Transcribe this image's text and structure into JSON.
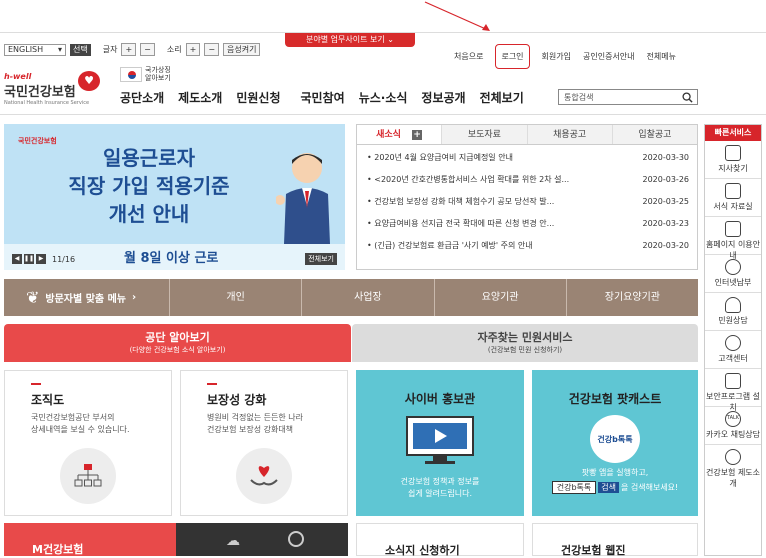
{
  "notice": {
    "label": "분야별 업무사이트 보기"
  },
  "util_left": {
    "language": "ENGLISH",
    "select_btn": "선택",
    "text_size": "글자",
    "sound": "소리",
    "plus": "+",
    "minus": "−",
    "voice_btn": "음성켜기"
  },
  "util_right": {
    "items": [
      "처음으로",
      "로그인",
      "회원가입",
      "공인인증서안내",
      "전체메뉴"
    ]
  },
  "logo": {
    "brand": "h-well",
    "name": "국민건강보험",
    "sub": "National Health Insurance Service",
    "gov": "국가상징 알아보기"
  },
  "gnb": {
    "items": [
      "공단소개",
      "제도소개",
      "민원신청",
      "국민참여",
      "뉴스·소식",
      "정보공개",
      "전체보기"
    ]
  },
  "search": {
    "placeholder": "통합검색"
  },
  "banner": {
    "brand": "국민건강보험",
    "line1": "일용근로자",
    "line2": "직장 가입 적용기준",
    "line3": "개선 안내",
    "footer": "월 8일 이상 근로",
    "page": "11/16",
    "all": "전체보기"
  },
  "news": {
    "tabs": [
      "새소식",
      "보도자료",
      "채용공고",
      "입찰공고"
    ],
    "plus": "+",
    "rows": [
      {
        "title": "2020년 4월 요양급여비 지급예정일 안내",
        "date": "2020-03-30"
      },
      {
        "title": "<2020년 간호간병통합서비스 사업 확대를 위한 2차 설...",
        "date": "2020-03-26"
      },
      {
        "title": "건강보험 보장성 강화 대책 체험수기 공모 당선작 발...",
        "date": "2020-03-25"
      },
      {
        "title": "요양급여비용 선지급 전국 확대에 따른 신청 변경 안...",
        "date": "2020-03-23"
      },
      {
        "title": "(긴급) 건강보험료 환급금 '사기 예방' 주의 안내",
        "date": "2020-03-20"
      }
    ]
  },
  "visitor_menu": {
    "title": "방문자별 맞춤 메뉴",
    "items": [
      "개인",
      "사업장",
      "요양기관",
      "장기요양기관"
    ]
  },
  "section_tabs": [
    {
      "title": "공단 알아보기",
      "sub": "(다양한 건강보험 소식 알아보기)"
    },
    {
      "title": "자주찾는 민원서비스",
      "sub": "(건강보험 민원 신청하기)"
    }
  ],
  "cards": [
    {
      "title": "조직도",
      "desc1": "국민건강보험공단 부서의",
      "desc2": "상세내역을 보실 수 있습니다."
    },
    {
      "title": "보장성 강화",
      "desc1": "병원비 걱정없는 든든한 나라",
      "desc2": "건강보험 보장성 강화대책"
    },
    {
      "title": "사이버 홍보관",
      "desc1": "건강보험 정책과 정보를",
      "desc2": "쉽게 알려드립니다."
    },
    {
      "title": "건강보험 팟캐스트",
      "desc1": "팟빵 앱을 실행하고,",
      "desc2": "을 검색해보세요!",
      "pill": "건강b톡톡",
      "pill_btn": "검색",
      "badge": "건강b톡톡"
    }
  ],
  "bottom_cards": [
    "M건강보험",
    "소식지 신청하기",
    "건강보험 웹진"
  ],
  "quick": {
    "title": "빠른서비스",
    "items": [
      "지사찾기",
      "서식 자료실",
      "홈페이지 이용안내",
      "인터넷납부",
      "민원상담",
      "고객센터",
      "보안프로그램 설치",
      "카카오 채팅상담",
      "건강보험 제도소개"
    ]
  },
  "colors": {
    "brand_red": "#d7252b",
    "menu_brown": "#9a8474",
    "banner_blue": "#bfe2f5",
    "teal": "#5fc6d3"
  }
}
